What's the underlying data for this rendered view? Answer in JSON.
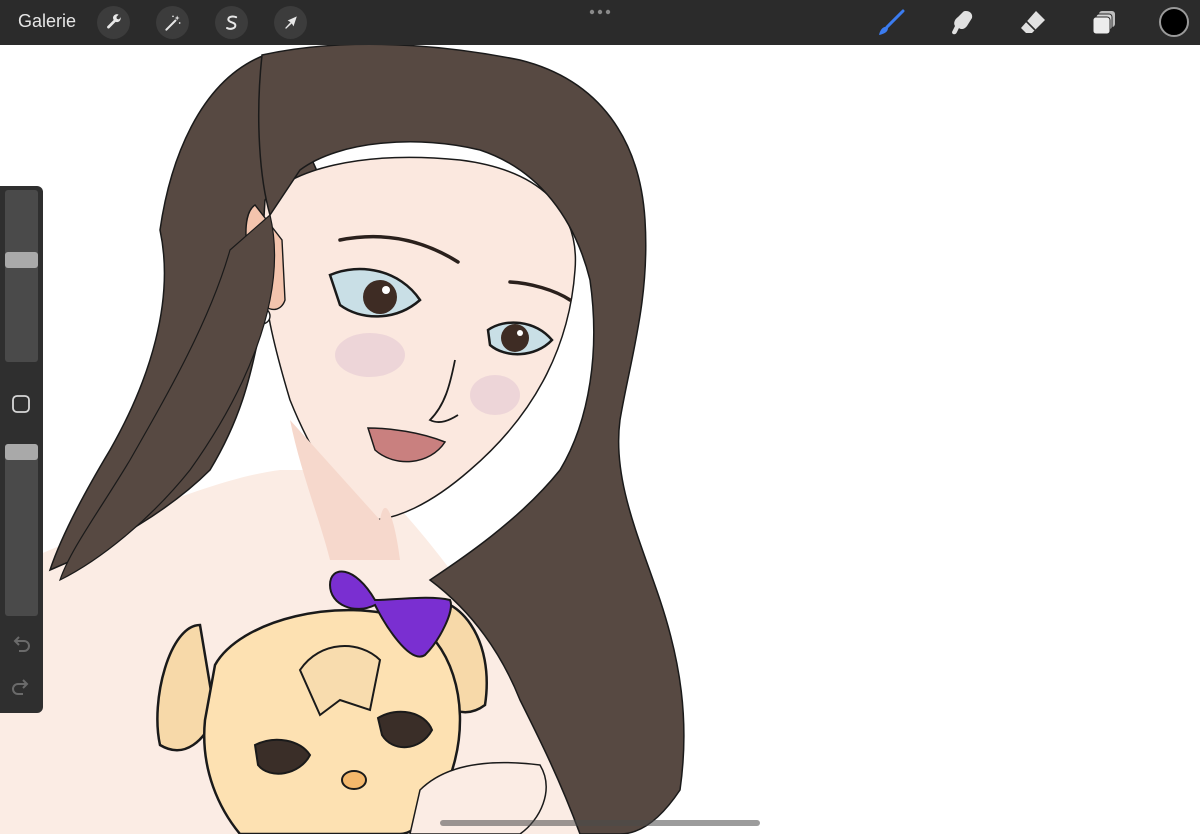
{
  "app": {
    "gallery_label": "Galerie"
  },
  "toolbar": {
    "left_tools": [
      {
        "name": "actions",
        "icon": "wrench-icon"
      },
      {
        "name": "adjustments",
        "icon": "magic-wand-icon"
      },
      {
        "name": "selection",
        "icon": "selection-s-icon"
      },
      {
        "name": "transform",
        "icon": "arrow-cursor-icon"
      }
    ],
    "more_icon": "more-dots-icon",
    "right_tools": [
      {
        "name": "brush",
        "icon": "brush-icon",
        "active": true
      },
      {
        "name": "smudge",
        "icon": "smudge-icon",
        "active": false
      },
      {
        "name": "eraser",
        "icon": "eraser-icon",
        "active": false
      },
      {
        "name": "layers",
        "icon": "layers-icon",
        "active": false
      }
    ],
    "current_color": "#000000",
    "active_tool_color": "#3b7cf0"
  },
  "sidebar": {
    "brush_size_level": 0.6,
    "opacity_level": 1.0,
    "undo_icon": "undo-icon",
    "redo_icon": "redo-icon",
    "modify_icon": "square-icon"
  },
  "canvas": {
    "background": "#ffffff"
  }
}
